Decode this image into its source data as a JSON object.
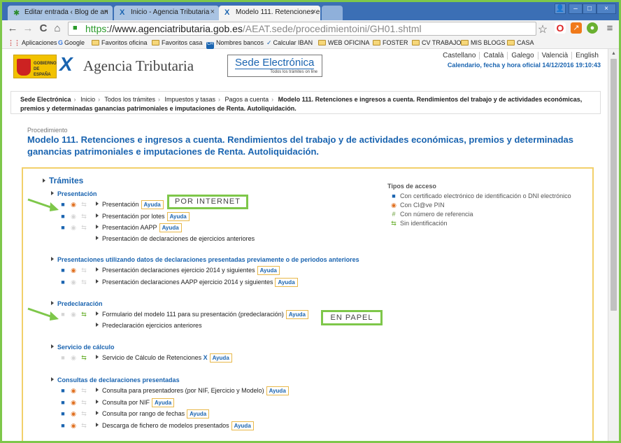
{
  "browser": {
    "tabs": [
      {
        "label": "Editar entrada ‹ Blog de an",
        "icon": "wordpress-icon"
      },
      {
        "label": "Inicio - Agencia Tributaria",
        "icon": "aeat-icon"
      },
      {
        "label": "Modelo 111. Retenciones e i",
        "icon": "aeat-icon",
        "active": true
      }
    ],
    "url_scheme": "https",
    "url_host": "://www.agenciatributaria.gob.es",
    "url_path": "/AEAT.sede/procedimientoini/GH01.shtml",
    "bookmarks": [
      "Aplicaciones",
      "Google",
      "Favoritos oficina",
      "Favoritos casa",
      "Nombres bancos",
      "Calcular IBAN",
      "WEB OFICINA",
      "FOSTER",
      "CV TRABAJO",
      "MIS BLOGS",
      "CASA"
    ],
    "glyphs": {
      "close": "×",
      "back": "←",
      "forward": "→",
      "reload": "C",
      "home": "⌂",
      "star": "☆",
      "menu": "≡",
      "minimize": "–",
      "maximize": "□",
      "user": "👤"
    }
  },
  "header": {
    "gob_text": "GOBIERNO DE ESPAÑA",
    "agency_name": "Agencia Tributaria",
    "sede_title": "Sede Electrónica",
    "sede_subtitle": "Todos los trámites on line",
    "languages": [
      "Castellano",
      "Català",
      "Galego",
      "Valencià",
      "English"
    ],
    "datetime": "Calendario, fecha y hora oficial 14/12/2016 19:10:43"
  },
  "breadcrumb": {
    "items": [
      "Sede Electrónica",
      "Inicio",
      "Todos los trámites",
      "Impuestos y tasas",
      "Pagos a cuenta"
    ],
    "current": "Modelo 111. Retenciones e ingresos a cuenta. Rendimientos del trabajo y de actividades económicas, premios y determinadas ganancias patrimoniales e imputaciones de Renta. Autoliquidación."
  },
  "procedure": {
    "label": "Procedimiento",
    "title": "Modelo 111. Retenciones e ingresos a cuenta. Rendimientos del trabajo y de actividades económicas, premios y determinadas ganancias patrimoniales e imputaciones de Renta. Autoliquidación."
  },
  "tramites": {
    "title": "Trámites",
    "ayuda_label": "Ayuda",
    "sections": [
      {
        "title": "Presentación",
        "rows": [
          {
            "text": "Presentación",
            "ayuda": true,
            "icons": [
              1,
              1,
              0,
              0
            ]
          },
          {
            "text": "Presentación por lotes",
            "ayuda": true,
            "icons": [
              1,
              0,
              0,
              0
            ]
          },
          {
            "text": "Presentación AAPP",
            "ayuda": true,
            "icons": [
              1,
              0,
              0,
              0
            ]
          },
          {
            "text": "Presentación de declaraciones de ejercicios anteriores",
            "ayuda": false,
            "icons": null
          }
        ]
      },
      {
        "title": "Presentaciones utilizando datos de declaraciones presentadas previamente o de periodos anteriores",
        "rows": [
          {
            "text": "Presentación declaraciones ejercicio 2014 y siguientes",
            "ayuda": true,
            "icons": [
              1,
              1,
              0,
              0
            ]
          },
          {
            "text": "Presentación declaraciones AAPP ejercicio 2014 y siguientes",
            "ayuda": true,
            "icons": [
              1,
              0,
              0,
              0
            ]
          }
        ]
      },
      {
        "title": "Predeclaración",
        "rows": [
          {
            "text": "Formulario del modelo 111 para su presentación (predeclaración)",
            "ayuda": true,
            "icons": [
              0,
              0,
              0,
              1
            ]
          },
          {
            "text": "Predeclaración ejercicios anteriores",
            "ayuda": false,
            "icons": null
          }
        ]
      },
      {
        "title": "Servicio de cálculo",
        "rows": [
          {
            "text": "Servicio de Cálculo de Retenciones",
            "ayuda": true,
            "icons": [
              0,
              0,
              0,
              1
            ],
            "extra_icon": true
          }
        ]
      },
      {
        "title": "Consultas de declaraciones presentadas",
        "rows": [
          {
            "text": "Consulta para presentadores (por NIF, Ejercicio y Modelo)",
            "ayuda": true,
            "icons": [
              1,
              1,
              0,
              0
            ]
          },
          {
            "text": "Consulta por NIF",
            "ayuda": true,
            "icons": [
              1,
              1,
              0,
              0
            ]
          },
          {
            "text": "Consulta por rango de fechas",
            "ayuda": true,
            "icons": [
              1,
              1,
              0,
              0
            ]
          },
          {
            "text": "Descarga de fichero de modelos presentados",
            "ayuda": true,
            "icons": [
              1,
              1,
              0,
              0
            ]
          }
        ]
      }
    ]
  },
  "tipos_acceso": {
    "title": "Tipos de acceso",
    "items": [
      {
        "icon": "lock-icon",
        "glyph": "🔒",
        "text": "Con certificado electrónico de identificación o DNI electrónico"
      },
      {
        "icon": "clave-pin-icon",
        "glyph": "◉",
        "text": "Con Cl@ve PIN"
      },
      {
        "icon": "hash-icon",
        "glyph": "#",
        "text": "Con número de referencia"
      },
      {
        "icon": "no-id-icon",
        "glyph": "⇆",
        "text": "Sin identificación"
      }
    ]
  },
  "callouts": {
    "internet": "POR INTERNET",
    "papel": "EN PAPEL"
  },
  "colors": {
    "callout_border": "#7ec74a",
    "link_blue": "#1a64b0",
    "panel_border": "#f2d06a",
    "tab_bar": "#3b6fb5"
  }
}
